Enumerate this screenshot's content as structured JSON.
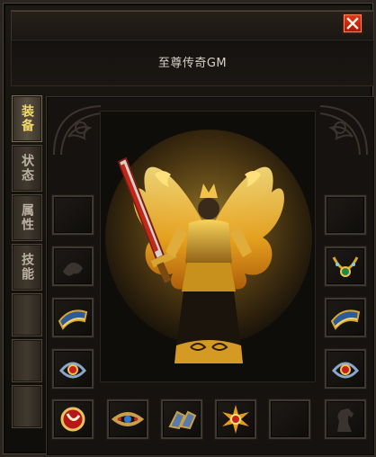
{
  "window": {
    "character_name": "至尊传奇GM",
    "close_icon": "close-x-icon"
  },
  "tabs": [
    {
      "label": "装备",
      "active": true
    },
    {
      "label": "状态",
      "active": false
    },
    {
      "label": "属性",
      "active": false
    },
    {
      "label": "技能",
      "active": false
    },
    {
      "label": "",
      "active": false
    },
    {
      "label": "",
      "active": false
    },
    {
      "label": "",
      "active": false
    }
  ],
  "character": {
    "figure": "golden-winged-warrior-with-sword"
  },
  "equipment_slots": {
    "left": [
      {
        "icon": "empty-slot"
      },
      {
        "icon": "faded-ghost-item-icon"
      },
      {
        "icon": "blue-gold-bracelet-icon"
      },
      {
        "icon": "red-gem-ring-icon"
      }
    ],
    "right": [
      {
        "icon": "empty-slot"
      },
      {
        "icon": "jeweled-necklace-icon"
      },
      {
        "icon": "blue-gold-bracelet-icon"
      },
      {
        "icon": "red-gem-ring-icon"
      }
    ],
    "bottom": [
      {
        "icon": "amulet-icon"
      },
      {
        "icon": "jeweled-belt-icon"
      },
      {
        "icon": "chain-boots-icon"
      },
      {
        "icon": "sun-gem-icon"
      },
      {
        "icon": "empty-slot"
      },
      {
        "icon": "horse-silhouette-icon"
      }
    ]
  },
  "colors": {
    "gold": "#f2c24a",
    "close_red": "#d62a14",
    "panel_border": "#3f3830"
  }
}
